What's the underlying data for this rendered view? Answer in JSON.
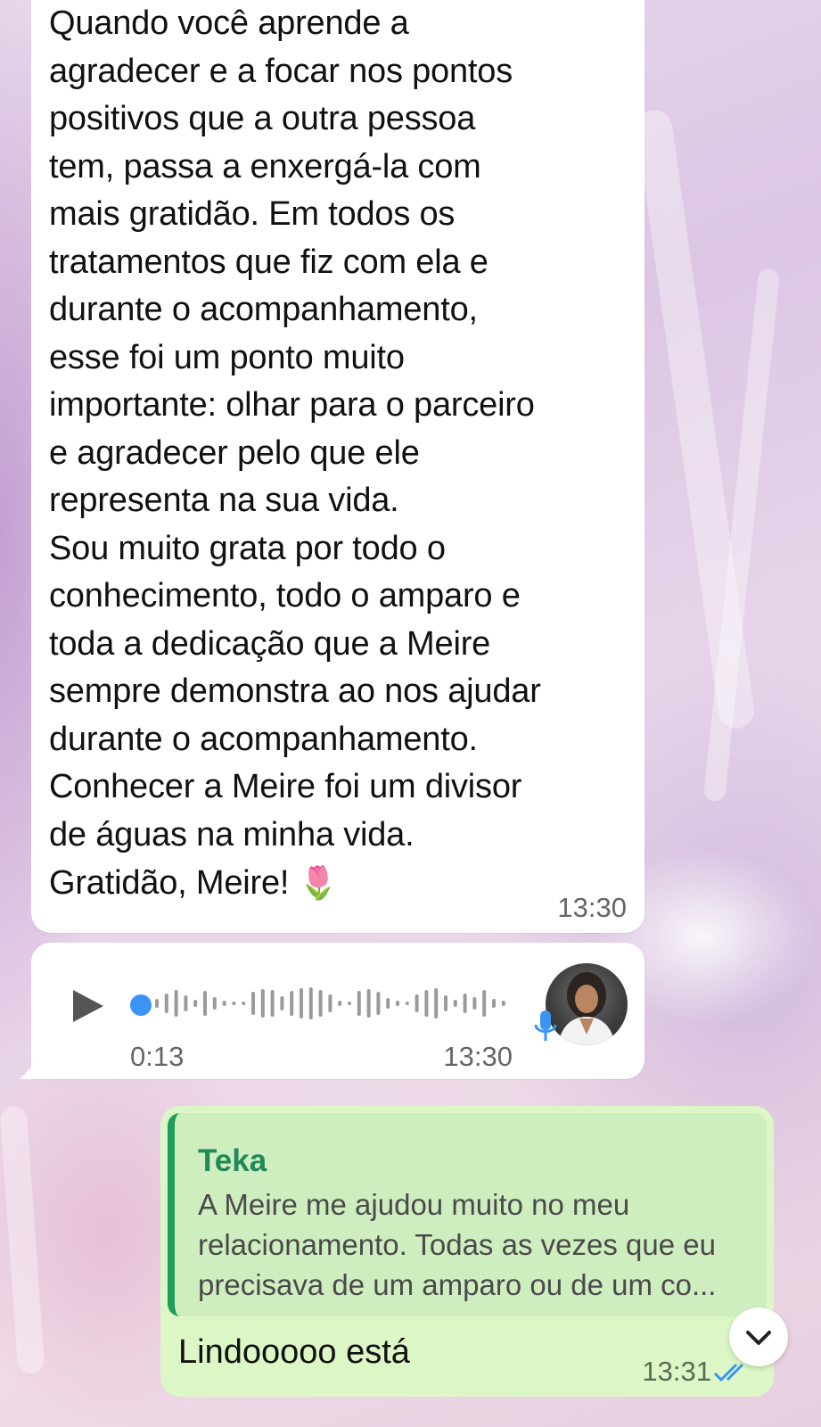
{
  "messages": {
    "incoming_text": {
      "body": "Quando você aprende a\nagradecer e a focar nos pontos\npositivos que a outra pessoa\ntem, passa a enxergá-la com\nmais gratidão. Em todos os\ntratamentos que fiz com ela e\ndurante o acompanhamento,\nesse foi um ponto muito\nimportante: olhar para o parceiro\ne agradecer pelo que ele\nrepresenta na sua vida.\nSou muito grata por todo o\nconhecimento, todo o amparo e\ntoda a dedicação que a Meire\nsempre demonstra ao nos ajudar\ndurante o acompanhamento.\nConhecer a Meire foi um divisor\nde águas na minha vida.\nGratidão, Meire! ",
      "emoji": "🌷",
      "time": "13:30"
    },
    "voice_note": {
      "duration": "0:13",
      "time": "13:30",
      "progress": 0,
      "play_icon": "play-icon",
      "mic_icon": "microphone-icon",
      "colors": {
        "progress_dot": "#3b93f5",
        "mic": "#3b93f5"
      }
    },
    "outgoing_reply": {
      "quoted_author": "Teka",
      "quoted_text": "A Meire me ajudou muito no meu\nrelacionamento. Todas as vezes que eu\nprecisava de um amparo ou de um co...",
      "body": "Lindooooo está",
      "time": "13:31",
      "status_icon": "double-check-read-icon",
      "colors": {
        "bubble": "#dcf7c5",
        "quote_accent": "#1f9d5a",
        "read_ticks": "#3b93f5"
      }
    }
  },
  "scroll_button": {
    "icon": "chevron-down-icon"
  }
}
